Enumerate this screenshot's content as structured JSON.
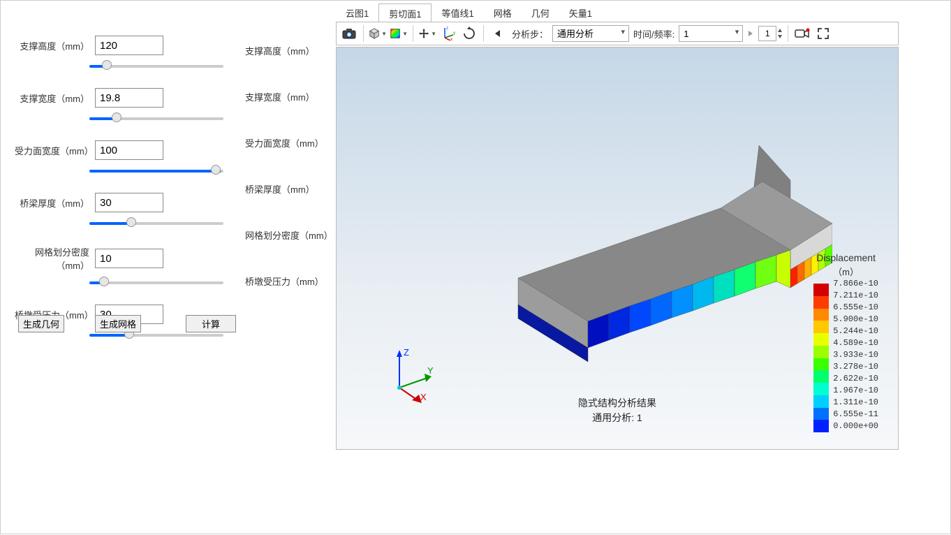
{
  "tabs": [
    "云图1",
    "剪切面1",
    "等值线1",
    "网格",
    "几何",
    "矢量1"
  ],
  "active_tab_index": 1,
  "params": [
    {
      "label": "支撑高度（mm）",
      "value": "120",
      "slider": 10,
      "label2": "支撑高度（mm）"
    },
    {
      "label": "支撑宽度（mm）",
      "value": "19.8",
      "slider": 18,
      "label2": "支撑宽度（mm）"
    },
    {
      "label": "受力面宽度（mm）",
      "value": "100",
      "slider": 98,
      "label2": "受力面宽度（mm）"
    },
    {
      "label": "桥梁厚度（mm）",
      "value": "30",
      "slider": 30,
      "label2": "桥梁厚度（mm）"
    },
    {
      "label": "网格划分密度（mm）",
      "value": "10",
      "slider": 8,
      "label2": "网格划分密度（mm）"
    },
    {
      "label": "桥墩受压力（mm）",
      "value": "30",
      "slider": 28,
      "label2": "桥墩受压力（mm）"
    }
  ],
  "buttons": {
    "gen_geom": "生成几何",
    "gen_mesh": "生成网格",
    "calc": "计算"
  },
  "toolbar": {
    "analysis_step_label": "分析步：",
    "analysis_step_value": "通用分析",
    "time_label": "时间/频率:",
    "time_value": "1",
    "spin_value": "1"
  },
  "result_text": {
    "line1": "隐式结构分析结果",
    "line2": "通用分析: 1"
  },
  "legend": {
    "title": "Displacement",
    "unit": "（m）",
    "values": [
      "7.866e-10",
      "7.211e-10",
      "6.555e-10",
      "5.900e-10",
      "5.244e-10",
      "4.589e-10",
      "3.933e-10",
      "3.278e-10",
      "2.622e-10",
      "1.967e-10",
      "1.311e-10",
      "6.555e-11",
      "0.000e+00"
    ],
    "colors": [
      "#d40000",
      "#ff3c00",
      "#ff8a00",
      "#ffc800",
      "#e8ff00",
      "#9cff00",
      "#3cff00",
      "#00ff6c",
      "#00ffd0",
      "#00d0ff",
      "#0070ff",
      "#0020ff"
    ]
  },
  "axes": {
    "x": "X",
    "y": "Y",
    "z": "Z"
  }
}
